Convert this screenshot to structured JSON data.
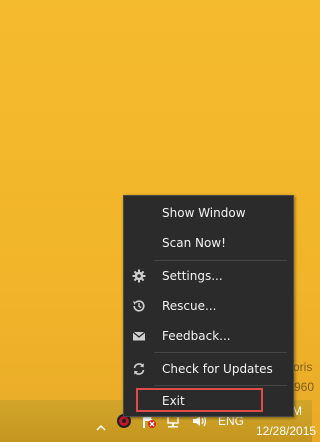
{
  "menu": {
    "items": [
      {
        "label": "Show Window",
        "icon": ""
      },
      {
        "label": "Scan Now!",
        "icon": ""
      },
      {
        "label": "Settings...",
        "icon": "gear-icon"
      },
      {
        "label": "Rescue...",
        "icon": "history-icon"
      },
      {
        "label": "Feedback...",
        "icon": "mail-icon"
      },
      {
        "label": "Check for Updates",
        "icon": "refresh-icon"
      },
      {
        "label": "Exit",
        "icon": ""
      }
    ],
    "highlight_color": "#e04a4a"
  },
  "taskbar": {
    "language": "ENG",
    "time": "M",
    "date": "12/28/2015",
    "tray_icons": [
      "chevron-up-icon",
      "antivirus-tray-icon",
      "action-center-icon",
      "network-icon",
      "volume-icon"
    ]
  },
  "background_partial_text": {
    "line1": "oris",
    "line2": "960"
  }
}
